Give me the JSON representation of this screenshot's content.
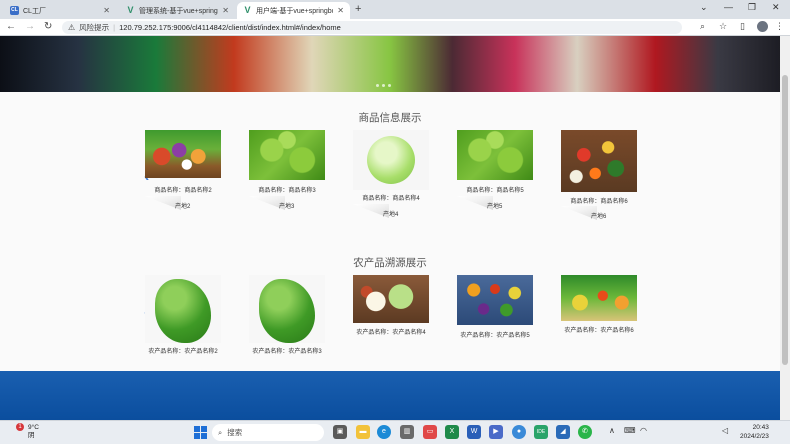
{
  "browser": {
    "tabs": [
      {
        "label": "CL工厂",
        "favicon": "cl-favicon-icon",
        "active": false
      },
      {
        "label": "管理系统-基于vue+springbo",
        "favicon": "vue-favicon-icon",
        "active": false
      },
      {
        "label": "用户端-基于vue+springboo",
        "favicon": "vue-favicon-icon",
        "active": true
      }
    ],
    "new_tab_symbol": "+",
    "address": {
      "risk_label": "风险提示",
      "url": "120.79.252.175:9006/cl4114842/client/dist/index.html#/index/home"
    }
  },
  "page": {
    "section1": {
      "title": "商品信息展示",
      "items": [
        {
          "name": "商品名称：商品名称2",
          "origin": "产地2"
        },
        {
          "name": "商品名称：商品名称3",
          "origin": "产地3"
        },
        {
          "name": "商品名称：商品名称4",
          "origin": "产地4"
        },
        {
          "name": "商品名称：商品名称5",
          "origin": "产地5"
        },
        {
          "name": "商品名称：商品名称6",
          "origin": "产地6"
        }
      ]
    },
    "section2": {
      "title": "农产品溯源展示",
      "items": [
        {
          "name": "农产品名称：农产品名称2"
        },
        {
          "name": "农产品名称：农产品名称3"
        },
        {
          "name": "农产品名称：农产品名称4"
        },
        {
          "name": "农产品名称：农产品名称5"
        },
        {
          "name": "农产品名称：农产品名称6"
        }
      ]
    },
    "colors": {
      "accent": "#3a7bd5",
      "footer": "#0b4e9e"
    }
  },
  "taskbar": {
    "weather": {
      "temp": "9°C",
      "condition": "阴",
      "badge": "1"
    },
    "search_placeholder": "搜索",
    "clock": {
      "time": "20:43",
      "date": "2024/2/23"
    }
  }
}
